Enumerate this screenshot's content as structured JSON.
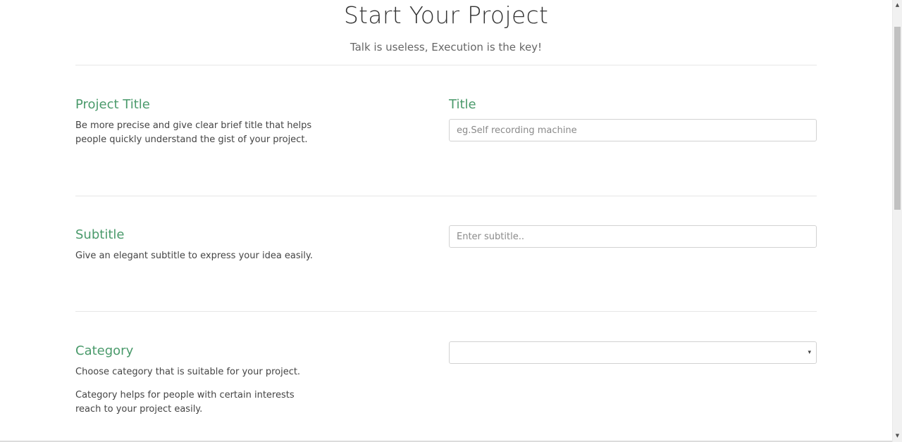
{
  "header": {
    "title": "Start Your Project",
    "subtitle": "Talk is useless, Execution is the key!"
  },
  "sections": {
    "project_title": {
      "heading": "Project Title",
      "description": "Be more precise and give clear brief title that helps people quickly understand the gist of your project.",
      "field_label": "Title",
      "field_placeholder": "eg.Self recording machine",
      "field_value": ""
    },
    "subtitle": {
      "heading": "Subtitle",
      "description": "Give an elegant subtitle to express your idea easily.",
      "field_placeholder": "Enter subtitle..",
      "field_value": ""
    },
    "category": {
      "heading": "Category",
      "description_1": "Choose category that is suitable for your project.",
      "description_2": "Category helps for people with certain interests reach to your project easily.",
      "selected_value": "",
      "caret_glyph": "▾"
    }
  },
  "scrollbar": {
    "up_glyph": "▲",
    "down_glyph": "▼"
  },
  "colors": {
    "accent": "#4a9a6b",
    "text": "#333333",
    "muted": "#666666",
    "border": "#d2d2d2",
    "divider": "#e6e6e6"
  }
}
